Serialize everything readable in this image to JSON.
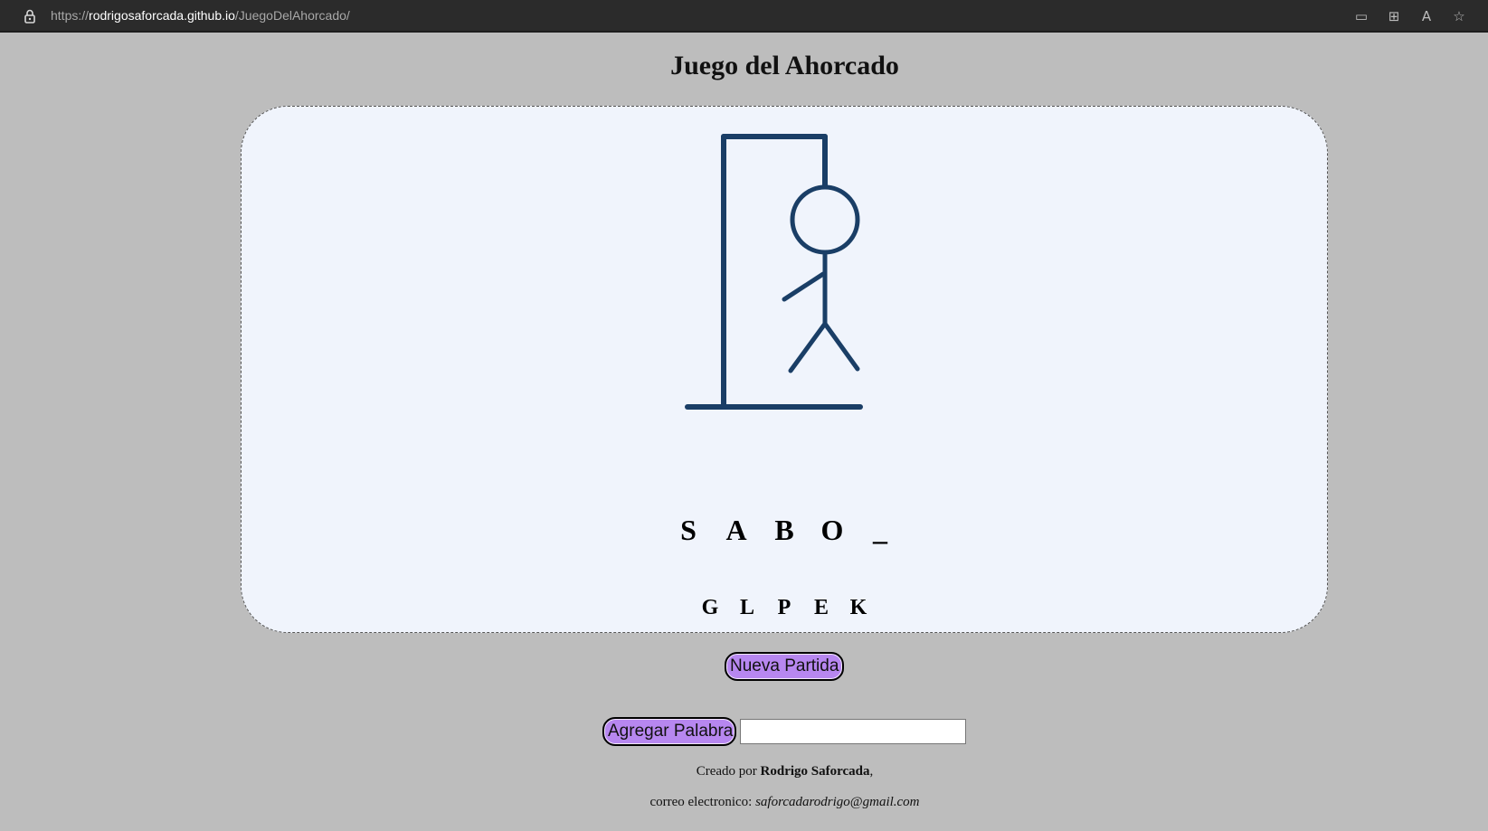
{
  "browser": {
    "url_prefix": "https://",
    "url_host": "rodrigosaforcada.github.io",
    "url_path": "/JuegoDelAhorcado/",
    "icons": [
      "devices-icon",
      "apps-icon",
      "read-aloud-icon",
      "favorites-icon"
    ]
  },
  "game": {
    "title": "Juego del Ahorcado",
    "word_letters": [
      "S",
      "A",
      "B",
      "O",
      "_"
    ],
    "wrong_letters": [
      "G",
      "L",
      "P",
      "E",
      "K"
    ],
    "errors_shown": 5,
    "errors_max": 6,
    "stroke_color": "#1a3e66"
  },
  "controls": {
    "new_game_label": "Nueva Partida",
    "add_word_label": "Agregar Palabra",
    "add_word_value": ""
  },
  "footer": {
    "created_prefix": "Creado por ",
    "author": "Rodrigo Saforcada",
    "created_suffix": ",",
    "email_prefix": "correo electronico: ",
    "email": "saforcadarodrigo@gmail.com"
  },
  "colors": {
    "background": "#bdbdbd",
    "board": "#f0f4fc",
    "button": "#b787f0",
    "address_bar": "#2b2b2b"
  }
}
